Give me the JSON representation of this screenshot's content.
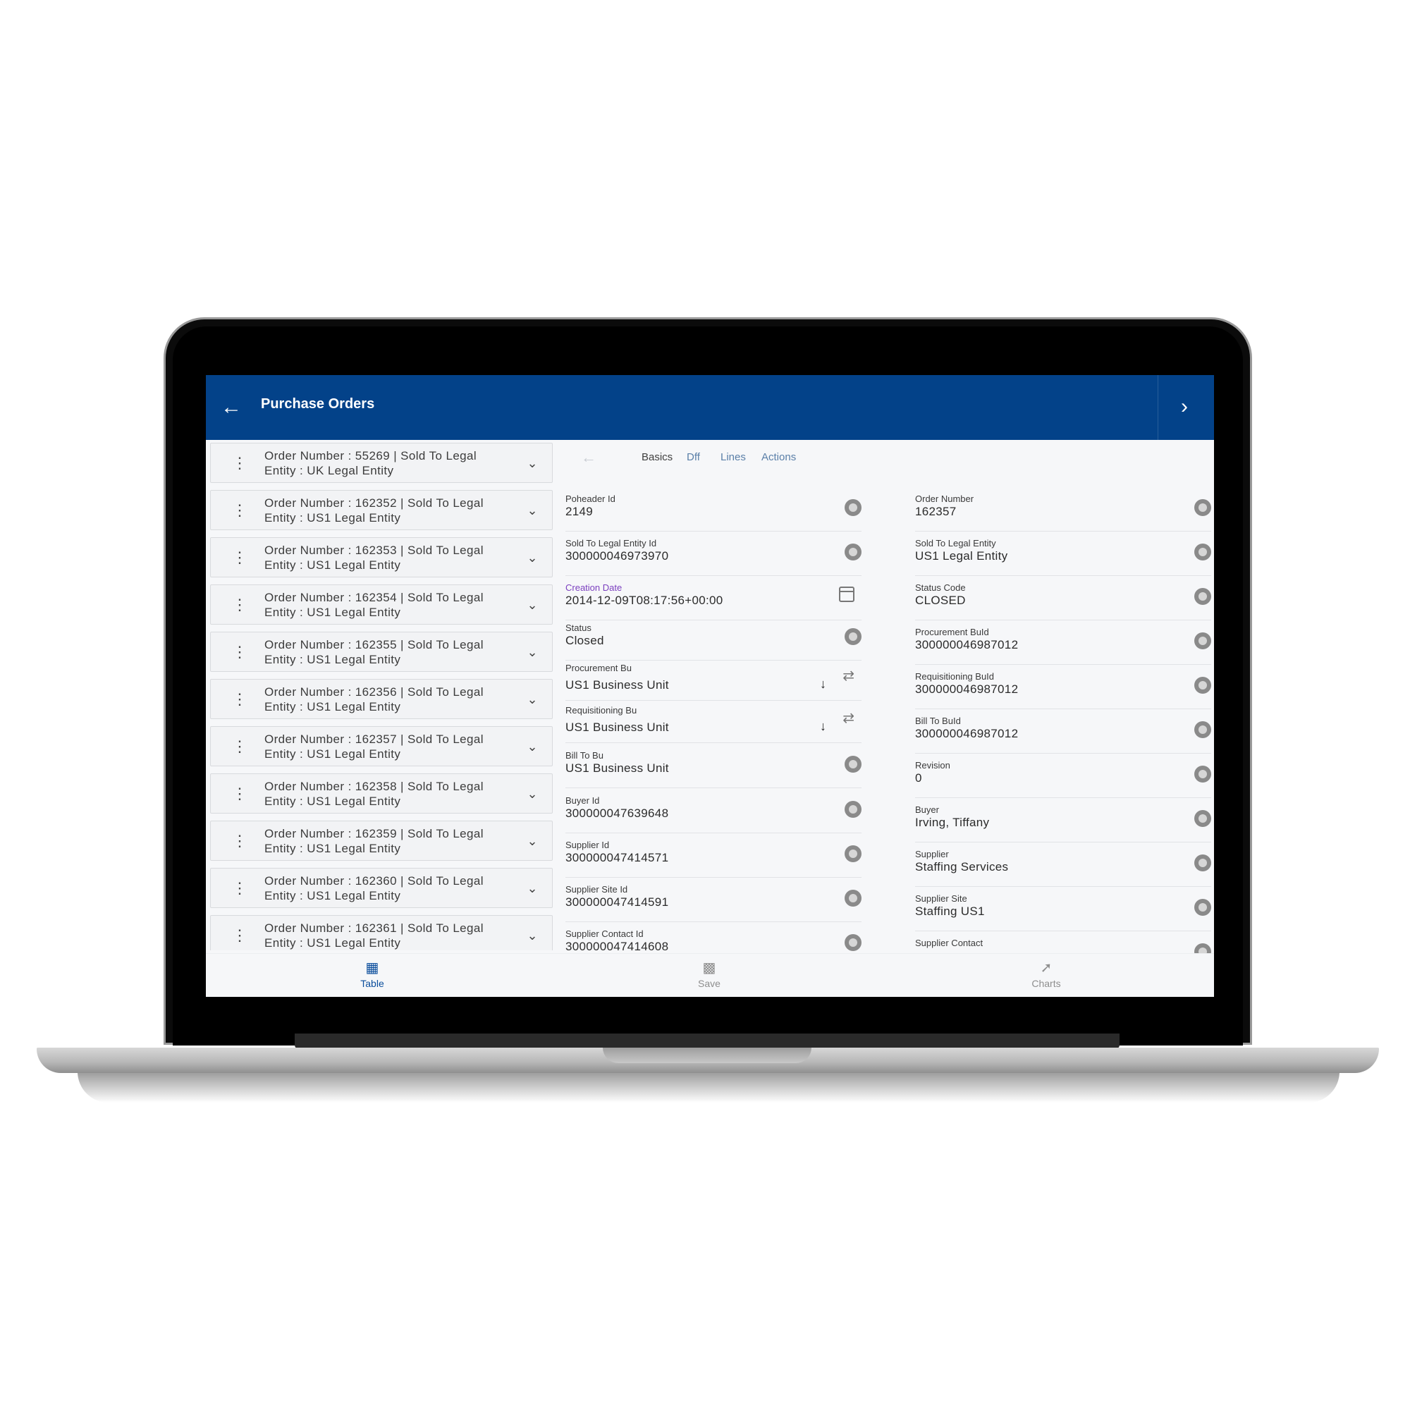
{
  "app": {
    "title": "Purchase Orders",
    "back_icon": "arrow-left-icon",
    "next_icon": "chevron-right-icon",
    "header_color": "#034289"
  },
  "list": {
    "items": [
      {
        "line1": "Order Number  : 55269 | Sold To Legal",
        "line2": "Entity  : UK Legal Entity"
      },
      {
        "line1": "Order Number  : 162352 | Sold To Legal",
        "line2": "Entity  : US1 Legal Entity"
      },
      {
        "line1": "Order Number  : 162353 | Sold To Legal",
        "line2": "Entity  : US1 Legal Entity"
      },
      {
        "line1": "Order Number  : 162354 | Sold To Legal",
        "line2": "Entity  : US1 Legal Entity"
      },
      {
        "line1": "Order Number  : 162355 | Sold To Legal",
        "line2": "Entity  : US1 Legal Entity"
      },
      {
        "line1": "Order Number  : 162356 | Sold To Legal",
        "line2": "Entity  : US1 Legal Entity"
      },
      {
        "line1": "Order Number  : 162357 | Sold To Legal",
        "line2": "Entity  : US1 Legal Entity"
      },
      {
        "line1": "Order Number  : 162358 | Sold To Legal",
        "line2": "Entity  : US1 Legal Entity"
      },
      {
        "line1": "Order Number  : 162359 | Sold To Legal",
        "line2": "Entity  : US1 Legal Entity"
      },
      {
        "line1": "Order Number  : 162360 | Sold To Legal",
        "line2": "Entity  : US1 Legal Entity"
      },
      {
        "line1": "Order Number  : 162361 | Sold To Legal",
        "line2": "Entity  : US1 Legal Entity"
      }
    ]
  },
  "tabs": [
    {
      "label": "Basics",
      "active": true
    },
    {
      "label": "Dff",
      "active": false
    },
    {
      "label": "Lines",
      "active": false
    },
    {
      "label": "Actions",
      "active": false
    }
  ],
  "fields_left": [
    {
      "label": "Poheader Id",
      "value": "2149"
    },
    {
      "label": "Sold To Legal Entity Id",
      "value": "300000046973970"
    },
    {
      "label": "Creation Date",
      "value": "2014-12-09T08:17:56+00:00"
    },
    {
      "label": "Status",
      "value": "Closed"
    },
    {
      "label": "Procurement Bu",
      "value": "US1 Business Unit"
    },
    {
      "label": "Requisitioning Bu",
      "value": "US1 Business Unit"
    },
    {
      "label": "Bill To Bu",
      "value": "US1 Business Unit"
    },
    {
      "label": "Buyer Id",
      "value": "300000047639648"
    },
    {
      "label": "Supplier Id",
      "value": "300000047414571"
    },
    {
      "label": "Supplier Site Id",
      "value": "300000047414591"
    },
    {
      "label": "Supplier Contact Id",
      "value": "300000047414608"
    }
  ],
  "fields_right": [
    {
      "label": "Order Number",
      "value": "162357"
    },
    {
      "label": "Sold To Legal Entity",
      "value": "US1 Legal Entity"
    },
    {
      "label": "Status Code",
      "value": "CLOSED"
    },
    {
      "label": "Procurement BuId",
      "value": "300000046987012"
    },
    {
      "label": "Requisitioning BuId",
      "value": "300000046987012"
    },
    {
      "label": "Bill To BuId",
      "value": "300000046987012"
    },
    {
      "label": "Revision",
      "value": "0"
    },
    {
      "label": "Buyer",
      "value": "Irving, Tiffany"
    },
    {
      "label": "Supplier",
      "value": "Staffing Services"
    },
    {
      "label": "Supplier Site",
      "value": "Staffing US1"
    },
    {
      "label": "Supplier Contact",
      "value": ""
    }
  ],
  "bottom_nav": [
    {
      "label": "Table",
      "icon": "table-grid-icon",
      "active": true
    },
    {
      "label": "Save",
      "icon": "save-screen-icon",
      "active": false
    },
    {
      "label": "Charts",
      "icon": "trend-chart-icon",
      "active": false
    }
  ]
}
